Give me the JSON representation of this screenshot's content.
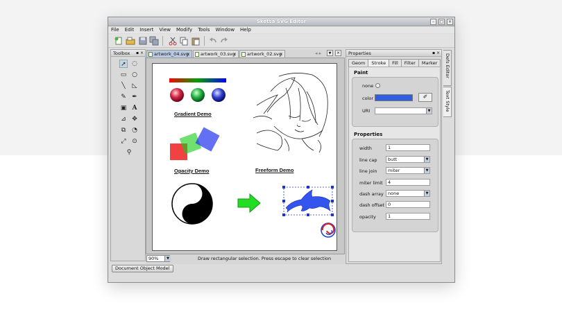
{
  "window": {
    "title": "Sketsa SVG Editor"
  },
  "menu": [
    "File",
    "Edit",
    "Insert",
    "View",
    "Modify",
    "Tools",
    "Window",
    "Help"
  ],
  "toolbar": {
    "icons": [
      "new-icon",
      "open-icon",
      "save-icon",
      "save-all-icon",
      "cut-icon",
      "copy-icon",
      "paste-icon",
      "undo-icon",
      "redo-icon"
    ]
  },
  "toolbox": {
    "title": "Toolbox"
  },
  "tabs": [
    {
      "label": "artwork_04.svg",
      "active": true
    },
    {
      "label": "artwork_03.svg",
      "active": false
    },
    {
      "label": "artwork_02.svg",
      "active": false
    }
  ],
  "canvas": {
    "labels": {
      "gradient": "Gradient Demo",
      "opacity": "Opacity Demo",
      "freeform": "Freeform Demo"
    }
  },
  "status": {
    "zoom": "90%",
    "message": "Draw rectangular selection. Press escape to clear selection"
  },
  "dom_button": "Document Object Model",
  "properties": {
    "title": "Properties",
    "tabs": [
      "Geom",
      "Stroke",
      "Fill",
      "Filter",
      "Marker"
    ],
    "active_tab": "Stroke",
    "paint": {
      "title": "Paint",
      "none_label": "none",
      "color_label": "color",
      "color_value": "#2f5fe0",
      "uri_label": "URI"
    },
    "props": {
      "title": "Properties",
      "width_label": "width",
      "width_value": "1",
      "linecap_label": "line cap",
      "linecap_value": "butt",
      "linejoin_label": "line join",
      "linejoin_value": "miter",
      "miterlimit_label": "miter limit",
      "miterlimit_value": "4",
      "dasharray_label": "dash array",
      "dasharray_value": "none",
      "dashoffset_label": "dash offset",
      "dashoffset_value": "0",
      "opacity_label": "opacity",
      "opacity_value": "1"
    }
  },
  "side_tabs": [
    "Defs Editor",
    "Text Style"
  ]
}
